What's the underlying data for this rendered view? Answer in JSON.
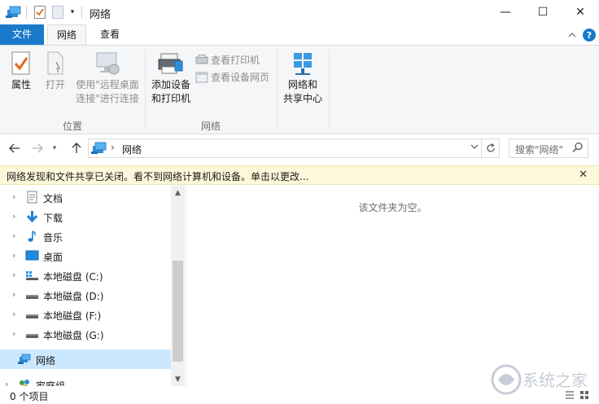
{
  "window": {
    "title": "网络",
    "controls": {
      "minimize": "—",
      "maximize": "☐",
      "close": "✕"
    }
  },
  "tabs": [
    {
      "label": "文件"
    },
    {
      "label": "网络"
    },
    {
      "label": "查看"
    }
  ],
  "ribbon": {
    "groups": [
      {
        "label": "位置"
      },
      {
        "label": "网络"
      }
    ],
    "buttons": {
      "properties": [
        "属性"
      ],
      "open": [
        "打开"
      ],
      "remote_desktop": [
        "使用\"远程桌面",
        "连接\"进行连接"
      ],
      "add_device": [
        "添加设备",
        "和打印机"
      ],
      "view_printers": "查看打印机",
      "view_device_webpage": "查看设备网页",
      "network_center": [
        "网络和",
        "共享中心"
      ]
    }
  },
  "address_bar": {
    "breadcrumb": "网络",
    "search_placeholder": "搜索\"网络\""
  },
  "info_bar": {
    "message": "网络发现和文件共享已关闭。看不到网络计算机和设备。单击以更改...",
    "close": "✕"
  },
  "nav_tree": [
    {
      "label": "文档",
      "icon": "document-icon"
    },
    {
      "label": "下载",
      "icon": "download-icon"
    },
    {
      "label": "音乐",
      "icon": "music-icon"
    },
    {
      "label": "桌面",
      "icon": "desktop-icon"
    },
    {
      "label": "本地磁盘 (C:)",
      "icon": "system-drive-icon"
    },
    {
      "label": "本地磁盘 (D:)",
      "icon": "drive-icon"
    },
    {
      "label": "本地磁盘 (F:)",
      "icon": "drive-icon"
    },
    {
      "label": "本地磁盘 (G:)",
      "icon": "drive-icon"
    },
    {
      "label": "网络",
      "icon": "network-icon",
      "selected": true
    },
    {
      "label": "家庭组",
      "icon": "homegroup-icon"
    }
  ],
  "content": {
    "empty_message": "该文件夹为空。"
  },
  "status_bar": {
    "item_count": "0 个项目"
  },
  "colors": {
    "accent": "#1979ca",
    "selection": "#cce8ff",
    "info_bar": "#fdf8d9"
  },
  "watermark": {
    "text": "系统之家"
  }
}
